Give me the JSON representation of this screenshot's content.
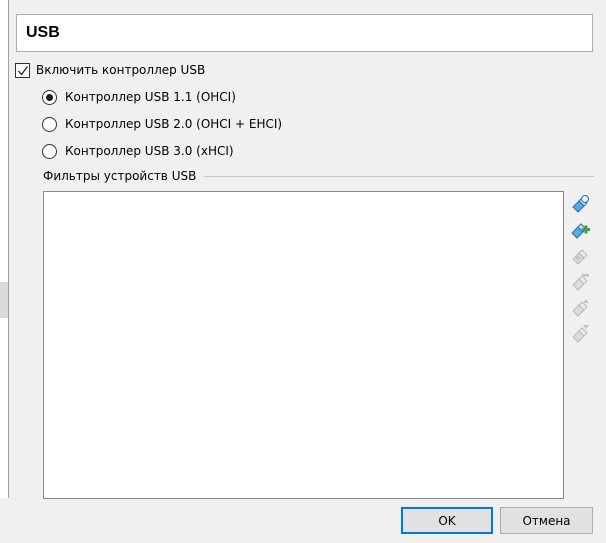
{
  "header": {
    "title": "USB"
  },
  "enable_controller": {
    "label": "Включить контроллер USB",
    "checked": true
  },
  "controllers": [
    {
      "label": "Контроллер USB 1.1 (OHCI)",
      "selected": true
    },
    {
      "label": "Контроллер USB 2.0 (OHCI + EHCI)",
      "selected": false
    },
    {
      "label": "Контроллер USB 3.0 (xHCI)",
      "selected": false
    }
  ],
  "filters": {
    "label": "Фильтры устройств USB",
    "items": []
  },
  "toolbar": {
    "icons": [
      {
        "name": "usb-filter-add-empty-icon",
        "enabled": true
      },
      {
        "name": "usb-filter-add-from-device-icon",
        "enabled": true
      },
      {
        "name": "usb-filter-edit-icon",
        "enabled": false
      },
      {
        "name": "usb-filter-remove-icon",
        "enabled": false
      },
      {
        "name": "usb-filter-move-up-icon",
        "enabled": false
      },
      {
        "name": "usb-filter-move-down-icon",
        "enabled": false
      }
    ]
  },
  "buttons": {
    "ok": "OK",
    "cancel": "Отмена"
  },
  "colors": {
    "accent": "#0078d7",
    "icon_enabled": "#3c8fd6",
    "icon_add": "#3fa63f",
    "icon_disabled": "#c4c4c4"
  }
}
